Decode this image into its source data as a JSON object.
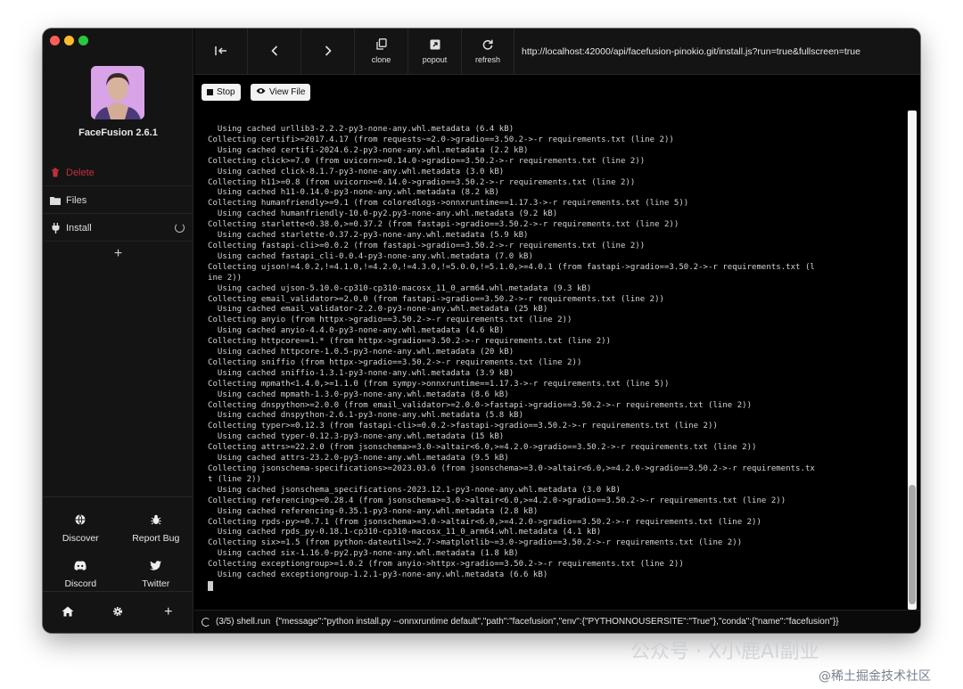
{
  "app": {
    "title": "FaceFusion 2.6.1"
  },
  "sidebar": {
    "items": [
      {
        "label": "Delete",
        "icon": "trash-icon"
      },
      {
        "label": "Files",
        "icon": "folder-icon"
      },
      {
        "label": "Install",
        "icon": "plug-icon"
      }
    ],
    "add_label": "+",
    "links": [
      {
        "label": "Discover",
        "icon": "globe-icon"
      },
      {
        "label": "Report Bug",
        "icon": "bug-icon"
      },
      {
        "label": "Discord",
        "icon": "discord-icon"
      },
      {
        "label": "Twitter",
        "icon": "twitter-icon"
      }
    ],
    "footer_add": "+"
  },
  "toolbar": {
    "clone_label": "clone",
    "popout_label": "popout",
    "refresh_label": "refresh",
    "url": "http://localhost:42000/api/facefusion-pinokio.git/install.js?run=true&fullscreen=true"
  },
  "actions": {
    "stop_label": "Stop",
    "view_file_label": "View File"
  },
  "terminal": {
    "lines": [
      "  Using cached urllib3-2.2.2-py3-none-any.whl.metadata (6.4 kB)",
      "Collecting certifi>=2017.4.17 (from requests~=2.0->gradio==3.50.2->-r requirements.txt (line 2))",
      "  Using cached certifi-2024.6.2-py3-none-any.whl.metadata (2.2 kB)",
      "Collecting click>=7.0 (from uvicorn>=0.14.0->gradio==3.50.2->-r requirements.txt (line 2))",
      "  Using cached click-8.1.7-py3-none-any.whl.metadata (3.0 kB)",
      "Collecting h11>=0.8 (from uvicorn>=0.14.0->gradio==3.50.2->-r requirements.txt (line 2))",
      "  Using cached h11-0.14.0-py3-none-any.whl.metadata (8.2 kB)",
      "Collecting humanfriendly>=9.1 (from coloredlogs->onnxruntime==1.17.3->-r requirements.txt (line 5))",
      "  Using cached humanfriendly-10.0-py2.py3-none-any.whl.metadata (9.2 kB)",
      "Collecting starlette<0.38.0,>=0.37.2 (from fastapi->gradio==3.50.2->-r requirements.txt (line 2))",
      "  Using cached starlette-0.37.2-py3-none-any.whl.metadata (5.9 kB)",
      "Collecting fastapi-cli>=0.0.2 (from fastapi->gradio==3.50.2->-r requirements.txt (line 2))",
      "  Using cached fastapi_cli-0.0.4-py3-none-any.whl.metadata (7.0 kB)",
      "Collecting ujson!=4.0.2,!=4.1.0,!=4.2.0,!=4.3.0,!=5.0.0,!=5.1.0,>=4.0.1 (from fastapi->gradio==3.50.2->-r requirements.txt (l",
      "ine 2))",
      "  Using cached ujson-5.10.0-cp310-cp310-macosx_11_0_arm64.whl.metadata (9.3 kB)",
      "Collecting email_validator>=2.0.0 (from fastapi->gradio==3.50.2->-r requirements.txt (line 2))",
      "  Using cached email_validator-2.2.0-py3-none-any.whl.metadata (25 kB)",
      "Collecting anyio (from httpx->gradio==3.50.2->-r requirements.txt (line 2))",
      "  Using cached anyio-4.4.0-py3-none-any.whl.metadata (4.6 kB)",
      "Collecting httpcore==1.* (from httpx->gradio==3.50.2->-r requirements.txt (line 2))",
      "  Using cached httpcore-1.0.5-py3-none-any.whl.metadata (20 kB)",
      "Collecting sniffio (from httpx->gradio==3.50.2->-r requirements.txt (line 2))",
      "  Using cached sniffio-1.3.1-py3-none-any.whl.metadata (3.9 kB)",
      "Collecting mpmath<1.4.0,>=1.1.0 (from sympy->onnxruntime==1.17.3->-r requirements.txt (line 5))",
      "  Using cached mpmath-1.3.0-py3-none-any.whl.metadata (8.6 kB)",
      "Collecting dnspython>=2.0.0 (from email_validator>=2.0.0->fastapi->gradio==3.50.2->-r requirements.txt (line 2))",
      "  Using cached dnspython-2.6.1-py3-none-any.whl.metadata (5.8 kB)",
      "Collecting typer>=0.12.3 (from fastapi-cli>=0.0.2->fastapi->gradio==3.50.2->-r requirements.txt (line 2))",
      "  Using cached typer-0.12.3-py3-none-any.whl.metadata (15 kB)",
      "Collecting attrs>=22.2.0 (from jsonschema>=3.0->altair<6.0,>=4.2.0->gradio==3.50.2->-r requirements.txt (line 2))",
      "  Using cached attrs-23.2.0-py3-none-any.whl.metadata (9.5 kB)",
      "Collecting jsonschema-specifications>=2023.03.6 (from jsonschema>=3.0->altair<6.0,>=4.2.0->gradio==3.50.2->-r requirements.tx",
      "t (line 2))",
      "  Using cached jsonschema_specifications-2023.12.1-py3-none-any.whl.metadata (3.0 kB)",
      "Collecting referencing>=0.28.4 (from jsonschema>=3.0->altair<6.0,>=4.2.0->gradio==3.50.2->-r requirements.txt (line 2))",
      "  Using cached referencing-0.35.1-py3-none-any.whl.metadata (2.8 kB)",
      "Collecting rpds-py>=0.7.1 (from jsonschema>=3.0->altair<6.0,>=4.2.0->gradio==3.50.2->-r requirements.txt (line 2))",
      "  Using cached rpds_py-0.18.1-cp310-cp310-macosx_11_0_arm64.whl.metadata (4.1 kB)",
      "Collecting six>=1.5 (from python-dateutil>=2.7->matplotlib~=3.0->gradio==3.50.2->-r requirements.txt (line 2))",
      "  Using cached six-1.16.0-py2.py3-none-any.whl.metadata (1.8 kB)",
      "Collecting exceptiongroup>=1.0.2 (from anyio->httpx->gradio==3.50.2->-r requirements.txt (line 2))",
      "  Using cached exceptiongroup-1.2.1-py3-none-any.whl.metadata (6.6 kB)"
    ]
  },
  "status": {
    "step": "(3/5) shell.run",
    "message": "{\"message\":\"python install.py --onnxruntime default\",\"path\":\"facefusion\",\"env\":{\"PYTHONNOUSERSITE\":\"True\"},\"conda\":{\"name\":\"facefusion\"}}"
  },
  "watermark": {
    "line1": "公众号 · X小鹿AI副业",
    "line2": "@稀土掘金技术社区"
  },
  "colors": {
    "delete": "#c0303a",
    "bg": "#000000",
    "sidebar": "#141414"
  }
}
